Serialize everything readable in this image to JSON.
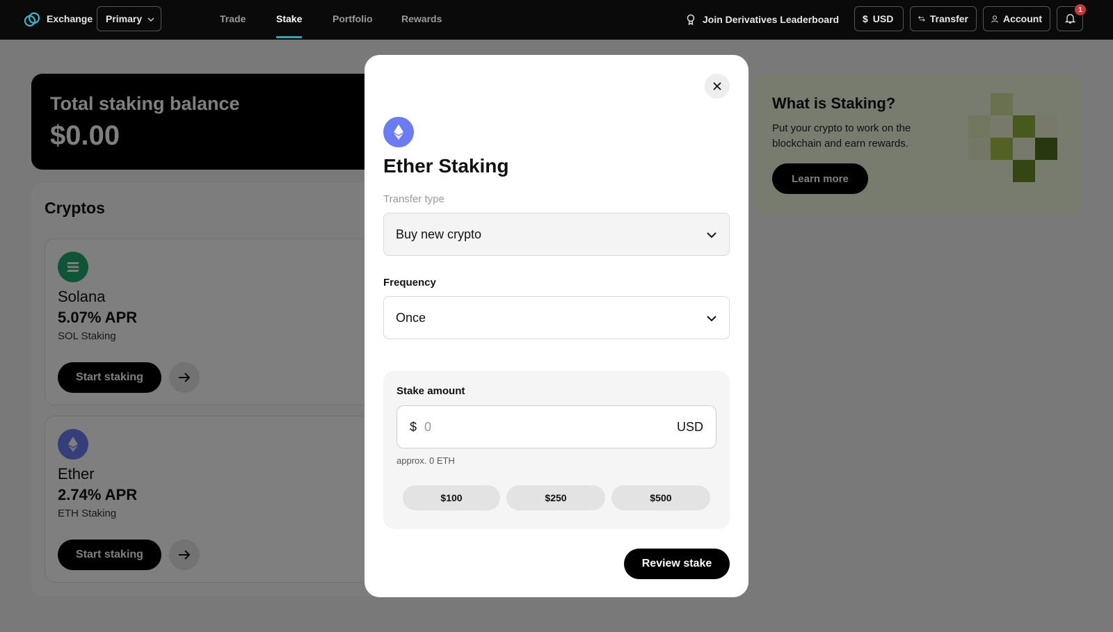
{
  "header": {
    "brand": "Exchange",
    "account_selector": "Primary",
    "tabs": [
      {
        "label": "Trade"
      },
      {
        "label": "Stake"
      },
      {
        "label": "Portfolio"
      },
      {
        "label": "Rewards"
      }
    ],
    "active_tab": "Stake",
    "leaderboard_link": "Join Derivatives Leaderboard",
    "currency_button": "USD",
    "transfer_button": "Transfer",
    "account_button": "Account",
    "notification_count": "1"
  },
  "balance": {
    "label": "Total staking balance",
    "value": "$0.00"
  },
  "cryptos": {
    "title": "Cryptos",
    "items": [
      {
        "name": "Solana",
        "apr": "5.07% APR",
        "subtitle": "SOL Staking",
        "button": "Start staking",
        "icon": "solana-icon",
        "color": "#1fa86a"
      },
      {
        "name": "Ether",
        "apr": "2.74% APR",
        "subtitle": "ETH Staking",
        "button": "Start staking",
        "icon": "ethereum-icon",
        "color": "#6b7cf2"
      }
    ]
  },
  "learn": {
    "title": "What is Staking?",
    "description": "Put your crypto to work on the blockchain and earn rewards.",
    "button": "Learn more"
  },
  "modal": {
    "title": "Ether Staking",
    "transfer_type_label": "Transfer type",
    "transfer_type_value": "Buy new crypto",
    "frequency_label": "Frequency",
    "frequency_value": "Once",
    "stake_amount_label": "Stake amount",
    "currency_symbol": "$",
    "amount_placeholder": "0",
    "amount_unit": "USD",
    "approx": "approx. 0 ETH",
    "presets": [
      "$100",
      "$250",
      "$500"
    ],
    "review_button": "Review stake"
  },
  "colors": {
    "accent": "#2fa6b5",
    "ether": "#6b7cf2",
    "solana": "#1fa86a",
    "learn_bg": "#f1f8de",
    "badge": "#c83a3a"
  }
}
